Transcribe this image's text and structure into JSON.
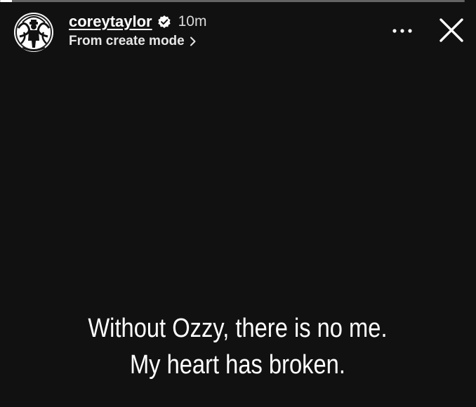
{
  "story": {
    "progress_fraction": 0.025
  },
  "header": {
    "username": "coreytaylor",
    "verified": true,
    "timestamp": "10m",
    "source_label": "From create mode",
    "avatar_icon": "profile-photo"
  },
  "controls": {
    "more_icon": "more-horizontal-icon",
    "close_icon": "close-icon"
  },
  "caption": {
    "line1": "Without Ozzy, there is no me.",
    "line2": "My heart has broken."
  },
  "colors": {
    "background": "#111111",
    "text": "#ffffff"
  }
}
